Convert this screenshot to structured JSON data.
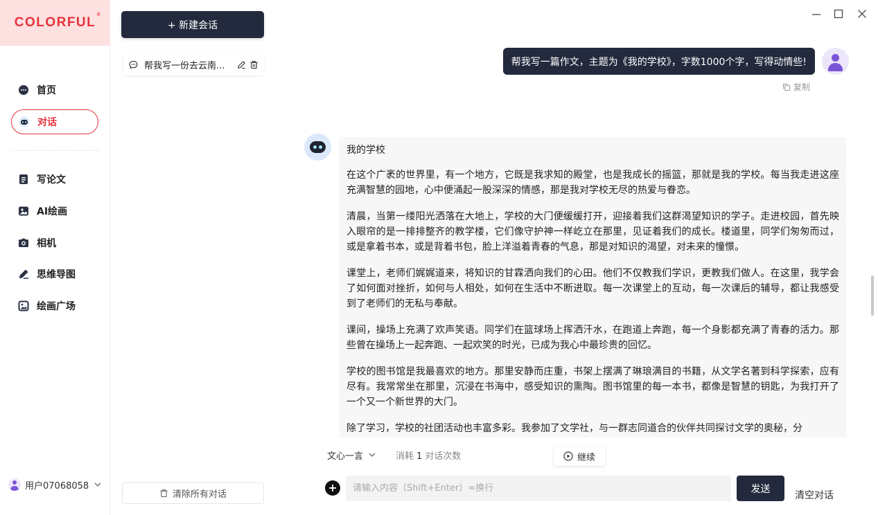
{
  "brand": {
    "logo_text": "COLORFUL",
    "logo_mark": "®",
    "accent": "#e8323c",
    "dark": "#232a3d"
  },
  "nav": {
    "items": [
      {
        "label": "首页",
        "icon": "chat-bubble-icon"
      },
      {
        "label": "对话",
        "icon": "robot-icon",
        "active": true
      },
      {
        "label": "写论文",
        "icon": "document-icon"
      },
      {
        "label": "AI绘画",
        "icon": "image-icon"
      },
      {
        "label": "相机",
        "icon": "camera-icon"
      },
      {
        "label": "思维导图",
        "icon": "pen-icon"
      },
      {
        "label": "绘画广场",
        "icon": "gallery-icon"
      }
    ],
    "user_name": "用户07068058"
  },
  "conversations": {
    "new_button": "+ 新建会话",
    "items": [
      {
        "title": "帮我写一份去云南..."
      }
    ],
    "clear_all": "清除所有对话"
  },
  "chat": {
    "user_message": "帮我写一篇作文，主题为《我的学校》，字数1000个字，写得动情些!",
    "copy_label": "复制",
    "answer_title": "我的学校",
    "answer_paragraphs": [
      "在这个广袤的世界里，有一个地方，它既是我求知的殿堂，也是我成长的摇篮，那就是我的学校。每当我走进这座充满智慧的园地，心中便涌起一股深深的情感，那是我对学校无尽的热爱与眷恋。",
      "清晨，当第一缕阳光洒落在大地上，学校的大门便缓缓打开，迎接着我们这群渴望知识的学子。走进校园，首先映入眼帘的是一排排整齐的教学楼，它们像守护神一样屹立在那里，见证着我们的成长。楼道里，同学们匆匆而过，或是拿着书本，或是背着书包，脸上洋溢着青春的气息，那是对知识的渴望，对未来的憧憬。",
      "课堂上，老师们娓娓道来，将知识的甘霖洒向我们的心田。他们不仅教我们学识，更教我们做人。在这里，我学会了如何面对挫折，如何与人相处，如何在生活中不断进取。每一次课堂上的互动，每一次课后的辅导，都让我感受到了老师们的无私与奉献。",
      "课间，操场上充满了欢声笑语。同学们在篮球场上挥洒汗水，在跑道上奔跑，每一个身影都充满了青春的活力。那些曾在操场上一起奔跑、一起欢笑的时光，已成为我心中最珍贵的回忆。",
      "学校的图书馆是我最喜欢的地方。那里安静而庄重，书架上摆满了琳琅满目的书籍，从文学名著到科学探索，应有尽有。我常常坐在那里，沉浸在书海中，感受知识的熏陶。图书馆里的每一本书，都像是智慧的钥匙，为我打开了一个又一个新世界的大门。",
      "除了学习，学校的社团活动也丰富多彩。我参加了文学社，与一群志同道合的伙伴共同探讨文学的奥秘，分"
    ]
  },
  "footer": {
    "model": "文心一言",
    "usage_prefix": "消耗",
    "usage_count": "1",
    "usage_suffix": "对话次数",
    "continue_label": "继续",
    "input_placeholder": "请输入内容（Shift+Enter）=换行",
    "input_value": "",
    "send_label": "发送",
    "clear_chat": "清空对话"
  }
}
